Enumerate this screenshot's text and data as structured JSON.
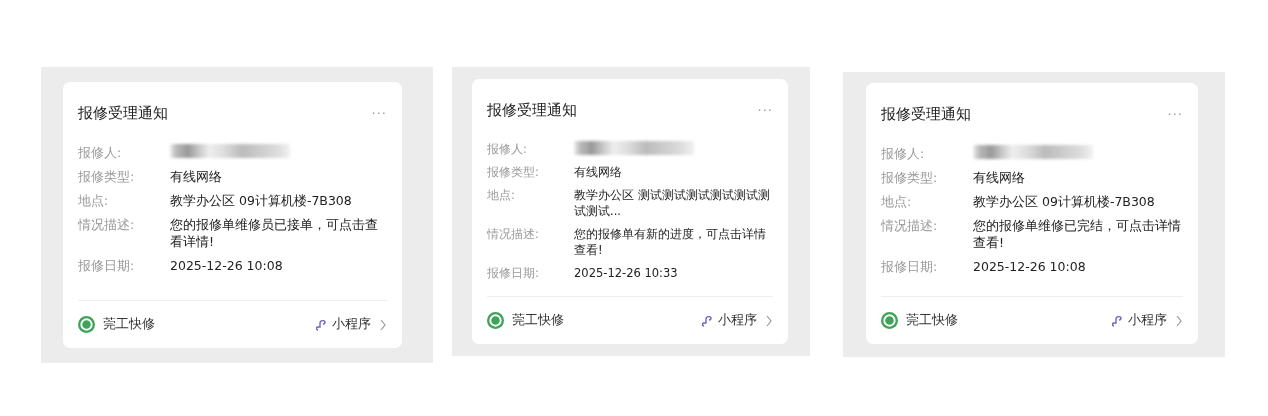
{
  "cards": [
    {
      "title": "报修受理通知",
      "menu": "···",
      "fields": [
        {
          "label": "报修人:",
          "kind": "redacted"
        },
        {
          "label": "报修类型:",
          "kind": "text",
          "value": "有线网络"
        },
        {
          "label": "地点:",
          "kind": "text",
          "value": "教学办公区 09计算机楼-7B308"
        },
        {
          "label": "情况描述:",
          "kind": "text",
          "value": "您的报修单维修员已接单，可点击查看详情!"
        },
        {
          "label": "报修日期:",
          "kind": "text",
          "value": "2025-12-26 10:08"
        }
      ],
      "source": "莞工快修",
      "link": "小程序"
    },
    {
      "title": "报修受理通知",
      "menu": "···",
      "fields": [
        {
          "label": "报修人:",
          "kind": "redacted"
        },
        {
          "label": "报修类型:",
          "kind": "text",
          "value": "有线网络"
        },
        {
          "label": "地点:",
          "kind": "text",
          "value": "教学办公区 测试测试测试测试测试测试测试..."
        },
        {
          "label": "情况描述:",
          "kind": "text",
          "value": "您的报修单有新的进度，可点击详情查看!"
        },
        {
          "label": "报修日期:",
          "kind": "text",
          "value": "2025-12-26 10:33"
        }
      ],
      "source": "莞工快修",
      "link": "小程序"
    },
    {
      "title": "报修受理通知",
      "menu": "···",
      "fields": [
        {
          "label": "报修人:",
          "kind": "redacted"
        },
        {
          "label": "报修类型:",
          "kind": "text",
          "value": "有线网络"
        },
        {
          "label": "地点:",
          "kind": "text",
          "value": "教学办公区 09计算机楼-7B308"
        },
        {
          "label": "情况描述:",
          "kind": "text",
          "value": "您的报修单维修已完结，可点击详情查看!"
        },
        {
          "label": "报修日期:",
          "kind": "text",
          "value": "2025-12-26 10:08"
        }
      ],
      "source": "莞工快修",
      "link": "小程序"
    }
  ]
}
